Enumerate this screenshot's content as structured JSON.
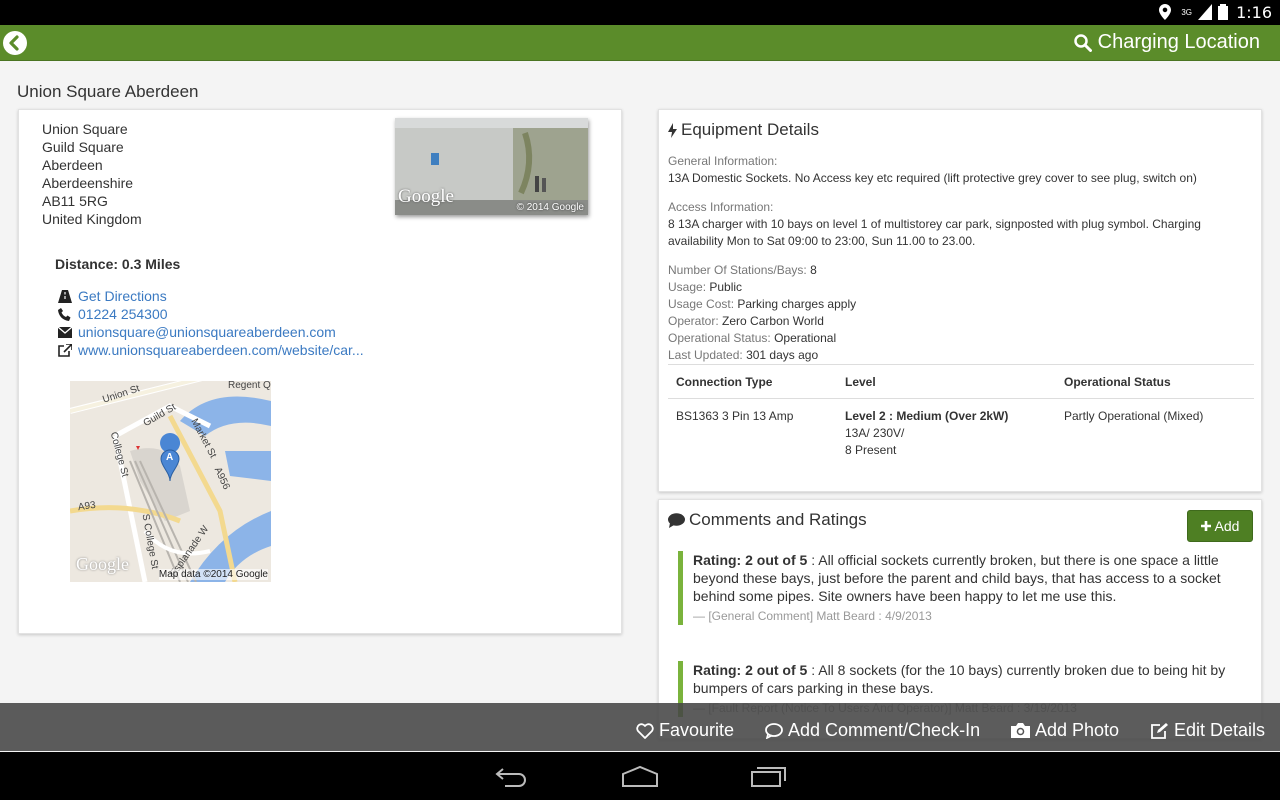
{
  "status_bar": {
    "time": "1:16",
    "network": "3G"
  },
  "action_bar": {
    "title": "Charging Location"
  },
  "location": {
    "name": "Union Square Aberdeen",
    "address": [
      "Union Square",
      "Guild Square",
      "Aberdeen",
      "Aberdeenshire",
      "AB11 5RG",
      "United Kingdom"
    ],
    "photo_watermark": "Google",
    "photo_copyright": "© 2014 Google",
    "distance": "Distance: 0.3 Miles",
    "contacts": {
      "directions": "Get Directions",
      "phone": "01224 254300",
      "email": "unionsquare@unionsquareaberdeen.com",
      "website": "www.unionsquareaberdeen.com/website/car..."
    },
    "map": {
      "streets": [
        "Union St",
        "Regent Q",
        "Guild St",
        "Market St",
        "College St",
        "A956",
        "A93",
        "S College St",
        "Esplanade W"
      ],
      "marker": "A",
      "watermark": "Google",
      "copyright": "Map data ©2014 Google"
    }
  },
  "equipment": {
    "heading": "Equipment Details",
    "general_label": "General Information:",
    "general_text": "13A Domestic Sockets. No Access key etc required (lift protective grey cover to see plug, switch on)",
    "access_label": "Access Information:",
    "access_text": "8 13A charger with 10 bays on level 1 of multistorey car park, signposted with plug symbol. Charging availability Mon to Sat 09:00 to 23:00, Sun 11.00 to 23.00.",
    "stations_label": "Number Of Stations/Bays:",
    "stations_value": "8",
    "usage_label": "Usage:",
    "usage_value": "Public",
    "cost_label": "Usage Cost:",
    "cost_value": "Parking charges apply",
    "operator_label": "Operator:",
    "operator_value": "Zero Carbon World",
    "status_label": "Operational Status:",
    "status_value": "Operational",
    "updated_label": "Last Updated:",
    "updated_value": "301 days ago",
    "table": {
      "headers": [
        "Connection Type",
        "Level",
        "Operational Status"
      ],
      "row": {
        "type": "BS1363 3 Pin 13 Amp",
        "level_title": "Level 2 : Medium (Over 2kW)",
        "level_detail": "13A/ 230V/",
        "level_present": "8 Present",
        "status": "Partly Operational (Mixed)"
      }
    }
  },
  "comments": {
    "heading": "Comments and Ratings",
    "add_label": "Add",
    "items": [
      {
        "rating": "Rating: 2 out of 5",
        "text": " : All official sockets currently broken, but there is one space a little beyond these bays, just before the parent and child bays, that has access to a socket behind some pipes. Site owners have been happy to let me use this.",
        "meta": "— [General Comment] Matt Beard : 4/9/2013"
      },
      {
        "rating": "Rating: 2 out of 5",
        "text": " : All 8 sockets (for the 10 bays) currently broken due to being hit by bumpers of cars parking in these bays.",
        "meta": "— [Fault Report (Notice To Users And Operator)] Matt Beard : 3/19/2013"
      }
    ]
  },
  "bottom_actions": {
    "favourite": "Favourite",
    "comment": "Add Comment/Check-In",
    "photo": "Add Photo",
    "edit": "Edit Details"
  },
  "colors": {
    "accent": "#5b8c2a",
    "link": "#3b7ac2",
    "comment_bar": "#7ab33c"
  }
}
